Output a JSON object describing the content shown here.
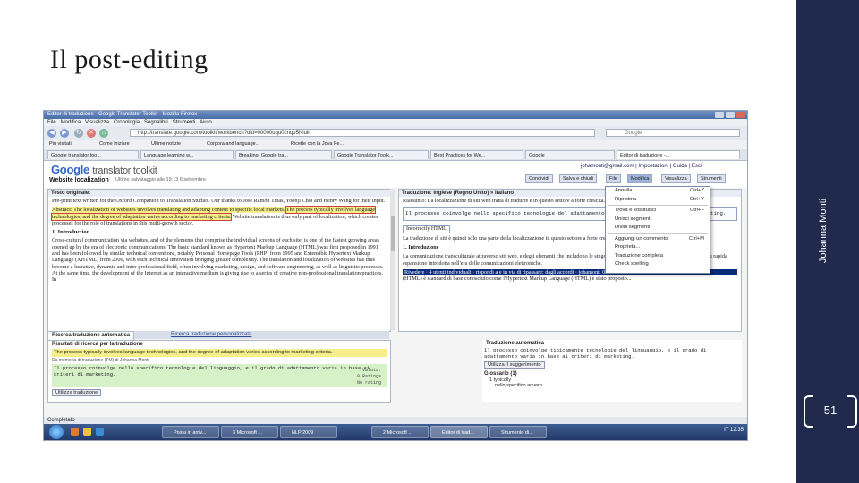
{
  "slide": {
    "title": "Il post-editing",
    "author": "Johanna Monti",
    "page_number": "51"
  },
  "browser": {
    "window_title": "Editor di traduzione - Google Translator Toolkit - Mozilla Firefox",
    "menu": [
      "File",
      "Modifica",
      "Visualizza",
      "Cronologia",
      "Segnalibri",
      "Strumenti",
      "Aiuto"
    ],
    "url": "http://translate.google.com/toolkit/workbench?did=00000uqu0cnqu5Nlull",
    "search_placeholder": "Google",
    "bookmarks": [
      "Più visitati",
      "Come iniziare",
      "Ultime notizie",
      "Corpora and language...",
      "Ricette con la Jova Fe..."
    ],
    "tabs": [
      "Google translator too...",
      "Language learning w...",
      "Breaking: Google tra...",
      "Google Translator Toolk...",
      "Best Practices for We...",
      "Google",
      "Editor di traduzione -..."
    ]
  },
  "gtt": {
    "logo_google": "Google",
    "logo_rest": "translator toolkit",
    "user_links": "johamonti@gmail.com | Impostazioni | Guida | Esci",
    "page_heading": "Website localization",
    "doc_meta": "Ultimo salvataggio alle 19:13 6 settembre",
    "buttons": {
      "share": "Condividi",
      "save": "Salva e chiudi",
      "file": "File",
      "edit": "Modifica",
      "view": "Visualizza",
      "tools": "Strumenti"
    },
    "source": {
      "header": "Testo originale:",
      "p1": "Pre-print text written for the Oxford Companion to Translation Studies. Our thanks to Jose Ramón Tibas, Yoonji Choi and Henry Wang for their input.",
      "abstract_start": "Abstract: The localization of websites involves translating and adapting content to specific local markets.",
      "abstract_hl": "The process typically involves language technologies, and the degree of adaptation varies according to marketing criteria.",
      "abstract_end": "Website translation is thus only part of localization, which creates processes for the role of translations in this multi-growth sector.",
      "intro_heading": "1. Introduction",
      "intro_text": "Cross-cultural communication via websites, and of the elements that comprise the individual screens of each site, is one of the fastest growing areas opened up by the era of electronic communications. The basic standard known as Hypertext Markup Language (HTML) was first proposed in 1991 and has been followed by similar technical conventions, notably Personal Homepage Tools (PHP) from 1995 and Extensible Hypertext Markup Language (XHTML) from 2000, with each technical innovation bringing greater complexity. The translation and localization of websites has thus become a lucrative, dynamic and inter-professional field, often involving marketing, design, and software engineering, as well as linguistic processes. At the same time, the development of the Internet as an interactive medium is giving rise to a series of creative non-professional translation practices. In"
    },
    "target": {
      "header": "Traduzione: Inglese (Regno Unito) » Italiano",
      "p1": "Riassunto: La localizzazione di siti web tratta di tradurre e in questo settore a forte crescita.",
      "edit_box": "Il processo coinvolge nello specifico tecnologie del adattamento varia in base ai criteri di marketing.",
      "format_select": "Incorrectly HTML",
      "p2": "La traduzione di siti è quindi solo una parte della localizzazione in questo settore a forte crescita.",
      "intro_heading": "1. Introduzione",
      "intro_text": "La comunicazione transculturale attraverso siti web, e degli elementi che includono le singole pagine di ciascun sito. È una delle aree di più rapida espansione introdotta nell'era delle comunicazioni elettroniche.",
      "review_bar": "Rivedere · 4 utenti individuali · rispondi a e in via di ripassare: dagli accordi · johamonti 04/10 10",
      "tail_text": "(HTML) è standard di base conosciuto come l'Hypertext Markup Language (HTML) è stato proposto..."
    },
    "context_menu": [
      {
        "label": "Annulla",
        "shortcut": "Ctrl+Z"
      },
      {
        "label": "Ripristina",
        "shortcut": "Ctrl+Y"
      },
      {
        "label": "Trova e sostituisci",
        "shortcut": "Ctrl+F"
      },
      {
        "label": "Unisci segmenti",
        "shortcut": ""
      },
      {
        "label": "Dividi segmenti",
        "shortcut": ""
      },
      {
        "label": "Aggiungi un commento",
        "shortcut": "Ctrl+M"
      },
      {
        "label": "Proprietà...",
        "shortcut": ""
      },
      {
        "label": "Traduzione completa",
        "shortcut": ""
      },
      {
        "label": "Check spelling",
        "shortcut": ""
      }
    ],
    "bottom_tabs": [
      "Ricerca traduzione automatica",
      "Ricerca traduzione personalizzata"
    ],
    "results": {
      "heading": "Risultati di ricerca per la traduzione",
      "source_hl": "The process typically involves language technologies, and the degree of adaptation varies according to marketing criteria.",
      "tm_label": "Da memoria di traduzione (TM) di Johanna Monti",
      "tm_text": "Il processo coinvolge nello specifico tecnologie del linguaggio, e il grado di adattamento varia in base ai criteri di marketing.",
      "use_button": "Utilizza traduzione",
      "rating_label": "Valuta:",
      "rating_count": "0 Ratings",
      "rating_value": "No rating"
    },
    "auto": {
      "heading": "Traduzione automatica",
      "text": "Il processo coinvolge tipicamente tecnologie del linguaggio, e il grado di adattamento varia in base ai criteri di marketing.",
      "use_button": "Utilizza il suggerimento",
      "glossary_heading": "Glossario (1)",
      "glossary_item": "1 typically",
      "glossary_trans": "nello specifico adverb"
    }
  },
  "status": "Completato",
  "taskbar": {
    "items": [
      "Posta in arriv...",
      "3 Microsoft ...",
      "NLP 2009",
      "2 Microsoft ...",
      "Editor di trad...",
      "Strumento di..."
    ],
    "clock": "IT 12:35"
  }
}
